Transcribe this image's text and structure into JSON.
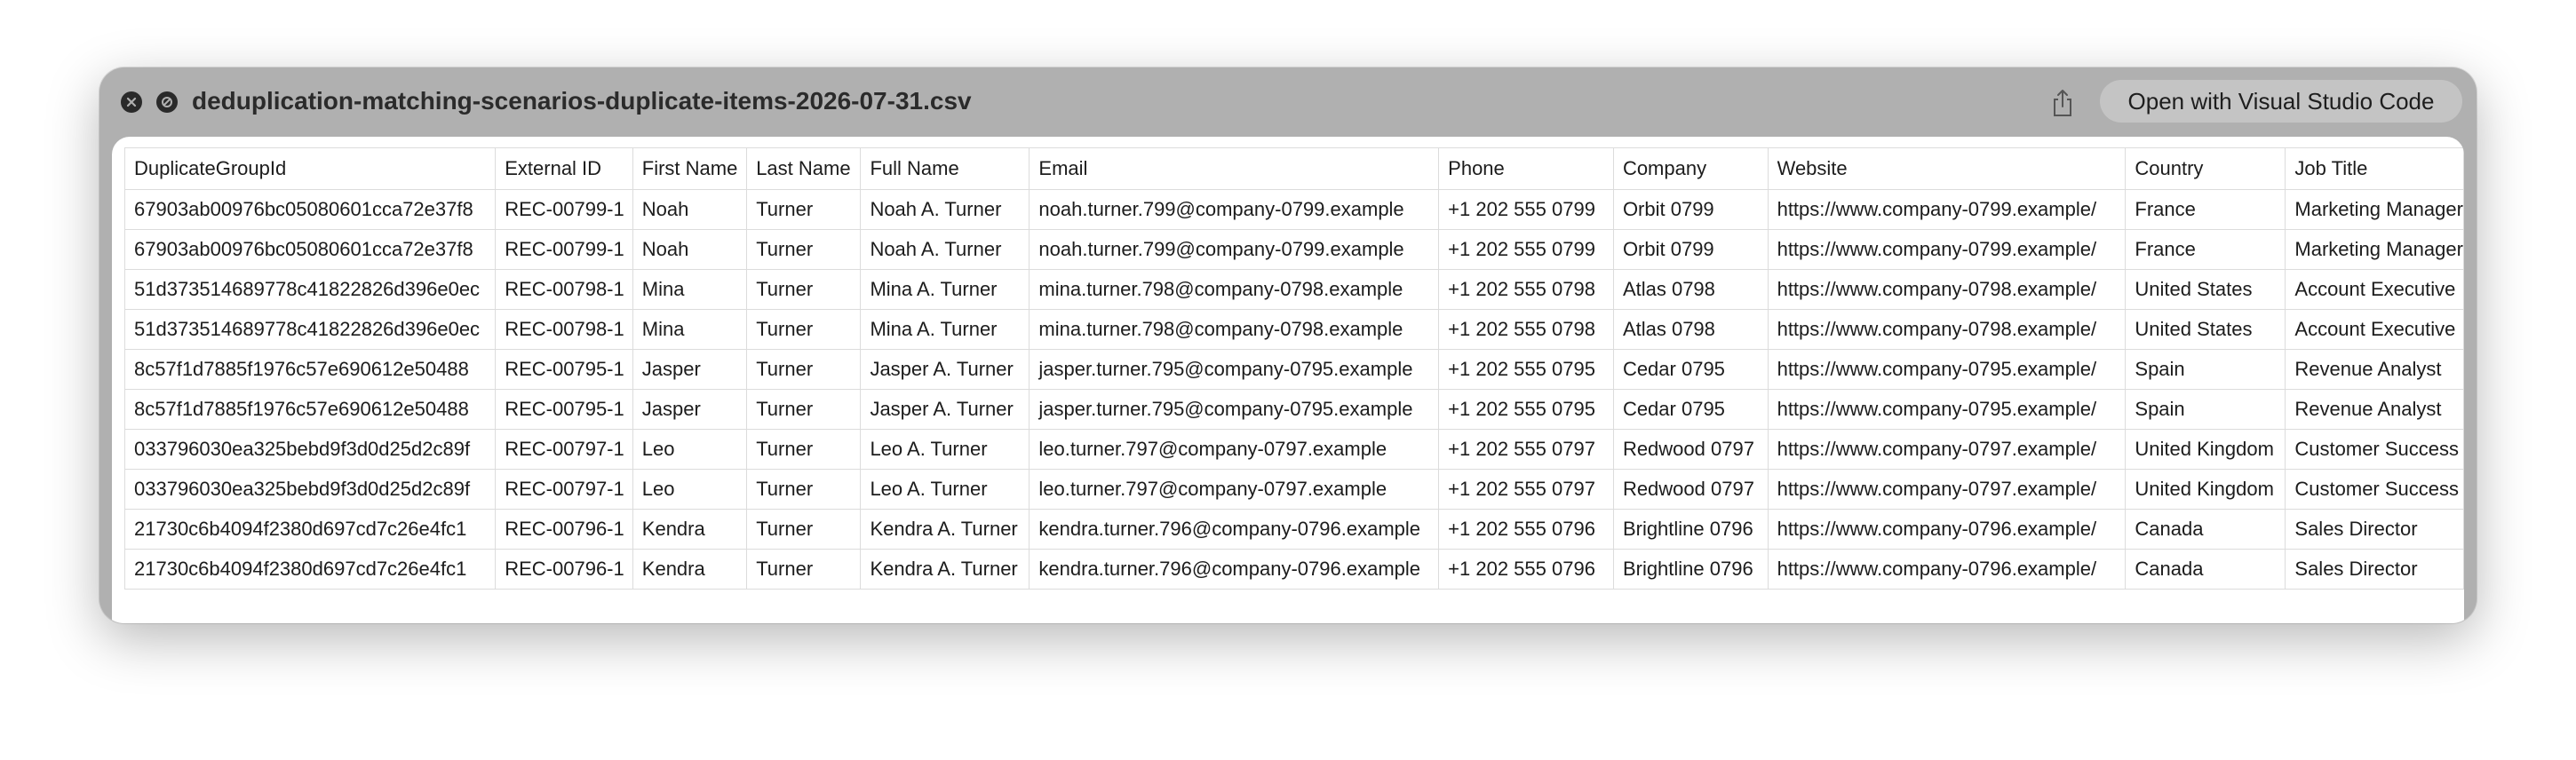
{
  "window": {
    "title": "deduplication-matching-scenarios-duplicate-items-2026-07-31.csv",
    "open_with_label": "Open with Visual Studio Code",
    "icons": {
      "close": "close-icon",
      "disable": "disable-icon",
      "share": "share-icon"
    }
  },
  "table": {
    "columns": [
      "DuplicateGroupId",
      "External ID",
      "First Name",
      "Last Name",
      "Full Name",
      "Email",
      "Phone",
      "Company",
      "Website",
      "Country",
      "Job Title"
    ],
    "rows": [
      [
        "67903ab00976bc05080601cca72e37f8",
        "REC-00799-1",
        "Noah",
        "Turner",
        "Noah A. Turner",
        "noah.turner.799@company-0799.example",
        "+1 202 555 0799",
        "Orbit 0799",
        "https://www.company-0799.example/",
        "France",
        "Marketing Manager"
      ],
      [
        "67903ab00976bc05080601cca72e37f8",
        "REC-00799-1",
        "Noah",
        "Turner",
        "Noah A. Turner",
        "noah.turner.799@company-0799.example",
        "+1 202 555 0799",
        "Orbit 0799",
        "https://www.company-0799.example/",
        "France",
        "Marketing Manager"
      ],
      [
        "51d373514689778c41822826d396e0ec",
        "REC-00798-1",
        "Mina",
        "Turner",
        "Mina A. Turner",
        "mina.turner.798@company-0798.example",
        "+1 202 555 0798",
        "Atlas 0798",
        "https://www.company-0798.example/",
        "United States",
        "Account Executive"
      ],
      [
        "51d373514689778c41822826d396e0ec",
        "REC-00798-1",
        "Mina",
        "Turner",
        "Mina A. Turner",
        "mina.turner.798@company-0798.example",
        "+1 202 555 0798",
        "Atlas 0798",
        "https://www.company-0798.example/",
        "United States",
        "Account Executive"
      ],
      [
        "8c57f1d7885f1976c57e690612e50488",
        "REC-00795-1",
        "Jasper",
        "Turner",
        "Jasper A. Turner",
        "jasper.turner.795@company-0795.example",
        "+1 202 555 0795",
        "Cedar 0795",
        "https://www.company-0795.example/",
        "Spain",
        "Revenue Analyst"
      ],
      [
        "8c57f1d7885f1976c57e690612e50488",
        "REC-00795-1",
        "Jasper",
        "Turner",
        "Jasper A. Turner",
        "jasper.turner.795@company-0795.example",
        "+1 202 555 0795",
        "Cedar 0795",
        "https://www.company-0795.example/",
        "Spain",
        "Revenue Analyst"
      ],
      [
        "033796030ea325bebd9f3d0d25d2c89f",
        "REC-00797-1",
        "Leo",
        "Turner",
        "Leo A. Turner",
        "leo.turner.797@company-0797.example",
        "+1 202 555 0797",
        "Redwood 0797",
        "https://www.company-0797.example/",
        "United Kingdom",
        "Customer Success"
      ],
      [
        "033796030ea325bebd9f3d0d25d2c89f",
        "REC-00797-1",
        "Leo",
        "Turner",
        "Leo A. Turner",
        "leo.turner.797@company-0797.example",
        "+1 202 555 0797",
        "Redwood 0797",
        "https://www.company-0797.example/",
        "United Kingdom",
        "Customer Success"
      ],
      [
        "21730c6b4094f2380d697cd7c26e4fc1",
        "REC-00796-1",
        "Kendra",
        "Turner",
        "Kendra A. Turner",
        "kendra.turner.796@company-0796.example",
        "+1 202 555 0796",
        "Brightline 0796",
        "https://www.company-0796.example/",
        "Canada",
        "Sales Director"
      ],
      [
        "21730c6b4094f2380d697cd7c26e4fc1",
        "REC-00796-1",
        "Kendra",
        "Turner",
        "Kendra A. Turner",
        "kendra.turner.796@company-0796.example",
        "+1 202 555 0796",
        "Brightline 0796",
        "https://www.company-0796.example/",
        "Canada",
        "Sales Director"
      ]
    ]
  }
}
